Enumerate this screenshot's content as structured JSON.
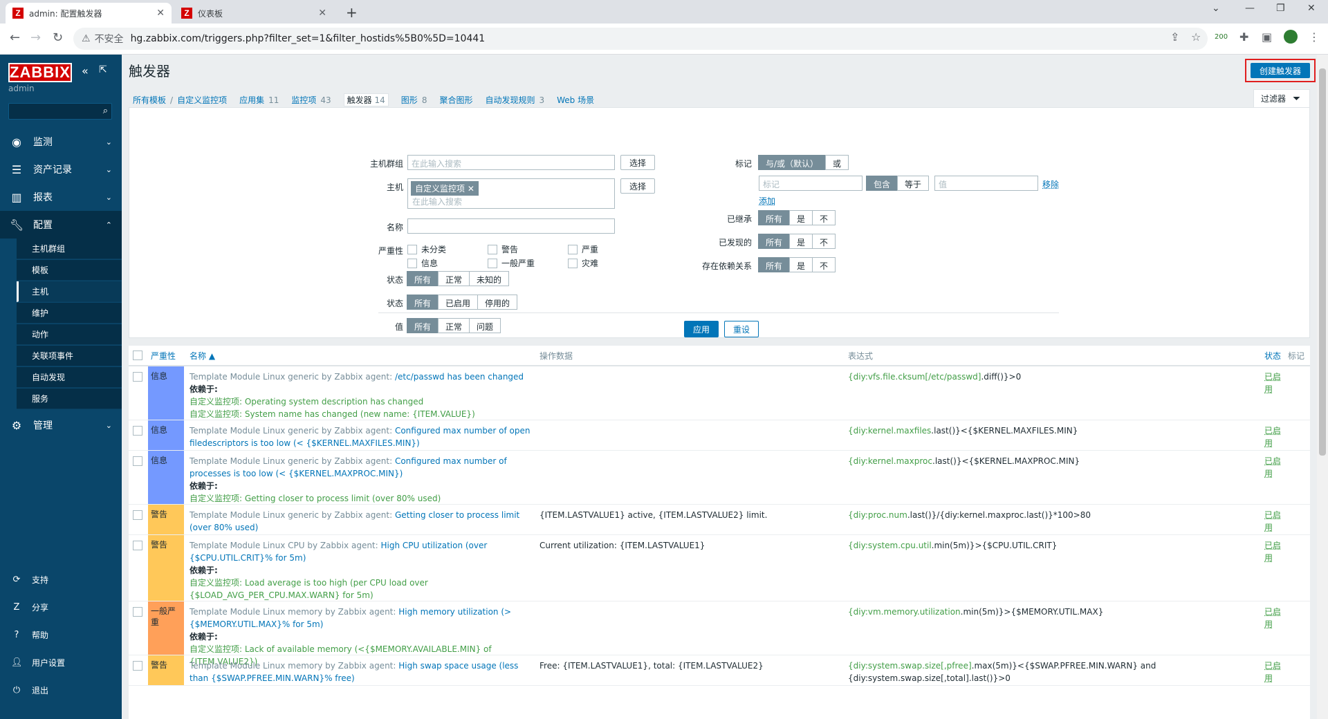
{
  "browser": {
    "tabs": [
      {
        "title": "admin: 配置触发器",
        "favicon": "Z"
      },
      {
        "title": "仪表板",
        "favicon": "Z"
      }
    ],
    "insecure": "不安全",
    "url": "hg.zabbix.com/triggers.php?filter_set=1&filter_hostids%5B0%5D=10441",
    "ext_badge": "200"
  },
  "sidebar": {
    "logo": "ZABBIX",
    "user": "admin",
    "menu": [
      {
        "label": "监测",
        "icon": "eye-icon"
      },
      {
        "label": "资产记录",
        "icon": "list-icon"
      },
      {
        "label": "报表",
        "icon": "bar-chart-icon"
      },
      {
        "label": "配置",
        "icon": "wrench-icon"
      }
    ],
    "config_items": [
      "主机群组",
      "模板",
      "主机",
      "维护",
      "动作",
      "关联项事件",
      "自动发现",
      "服务"
    ],
    "admin": {
      "label": "管理",
      "icon": "gear-icon"
    },
    "bottom": [
      {
        "label": "支持",
        "icon": "support-icon"
      },
      {
        "label": "分享",
        "icon": "share-icon"
      },
      {
        "label": "帮助",
        "icon": "help-icon"
      },
      {
        "label": "用户设置",
        "icon": "user-icon"
      },
      {
        "label": "退出",
        "icon": "power-icon"
      }
    ]
  },
  "header": {
    "title": "触发器",
    "create_button": "创建触发器"
  },
  "breadcrumb": {
    "all_templates": "所有模板",
    "separator": "/",
    "host": "自定义监控项",
    "apps": "应用集",
    "apps_count": "11",
    "items": "监控项",
    "items_count": "43",
    "triggers": "触发器",
    "triggers_count": "14",
    "graphs": "图形",
    "graphs_count": "8",
    "screens": "聚合图形",
    "discovery": "自动发现规则",
    "discovery_count": "3",
    "web": "Web 场景"
  },
  "filter": {
    "tab_label": "过滤器",
    "host_group_label": "主机群组",
    "host_label": "主机",
    "name_label": "名称",
    "severity_label": "严重性",
    "state_label": "状态",
    "status_label": "状态",
    "value_label": "值",
    "search_placeholder": "在此输入搜索",
    "select": "选择",
    "host_chip": "自定义监控项",
    "severities": [
      "未分类",
      "警告",
      "严重",
      "信息",
      "一般严重",
      "灾难"
    ],
    "state_opts": [
      "所有",
      "正常",
      "未知的"
    ],
    "status_opts": [
      "所有",
      "已启用",
      "停用的"
    ],
    "value_opts": [
      "所有",
      "正常",
      "问题"
    ],
    "tags_label": "标记",
    "tags_opts": [
      "与/或（默认）",
      "或"
    ],
    "tag_placeholder": "标记",
    "tag_ops": [
      "包含",
      "等于"
    ],
    "value_placeholder": "值",
    "remove": "移除",
    "add": "添加",
    "inherited_label": "已继承",
    "discovered_label": "已发现的",
    "depends_label": "存在依赖关系",
    "yn_opts": [
      "所有",
      "是",
      "不"
    ],
    "apply": "应用",
    "reset": "重设"
  },
  "table": {
    "headers": {
      "severity": "严重性",
      "name": "名称 ▲",
      "ops": "操作数据",
      "expr": "表达式",
      "status": "状态",
      "tags": "标记"
    },
    "depends_label": "依赖于:",
    "rows": [
      {
        "severity": "信息",
        "color": "#7499ff",
        "tpl": "Template Module Linux generic by Zabbix agent: ",
        "name": "/etc/passwd has been changed",
        "deps": [
          "自定义监控项: Operating system description has changed",
          "自定义监控项: System name has changed (new name: {ITEM.VALUE})"
        ],
        "ops": "",
        "expr_g": "{diy:vfs.file.cksum[/etc/passwd]",
        "expr_rest": ".diff()}>0",
        "status": "已启用"
      },
      {
        "severity": "信息",
        "color": "#7499ff",
        "tpl": "Template Module Linux generic by Zabbix agent: ",
        "name": "Configured max number of open filedescriptors is too low (< {$KERNEL.MAXFILES.MIN})",
        "deps": [],
        "ops": "",
        "expr_g": "{diy:kernel.maxfiles",
        "expr_rest": ".last()}<{$KERNEL.MAXFILES.MIN}",
        "status": "已启用"
      },
      {
        "severity": "信息",
        "color": "#7499ff",
        "tpl": "Template Module Linux generic by Zabbix agent: ",
        "name": "Configured max number of processes is too low (< {$KERNEL.MAXPROC.MIN})",
        "deps": [
          "自定义监控项: Getting closer to process limit (over 80% used)"
        ],
        "ops": "",
        "expr_g": "{diy:kernel.maxproc",
        "expr_rest": ".last()}<{$KERNEL.MAXPROC.MIN}",
        "status": "已启用"
      },
      {
        "severity": "警告",
        "color": "#ffc859",
        "tpl": "Template Module Linux generic by Zabbix agent: ",
        "name": "Getting closer to process limit (over 80% used)",
        "deps": [],
        "ops": "{ITEM.LASTVALUE1} active, {ITEM.LASTVALUE2} limit.",
        "expr_g": "{diy:proc.num",
        "expr_rest": ".last()}/{diy:kernel.maxproc.last()}*100>80",
        "status": "已启用"
      },
      {
        "severity": "警告",
        "color": "#ffc859",
        "tpl": "Template Module Linux CPU by Zabbix agent: ",
        "name": "High CPU utilization (over {$CPU.UTIL.CRIT}% for 5m)",
        "deps": [
          "自定义监控项: Load average is too high (per CPU load over {$LOAD_AVG_PER_CPU.MAX.WARN} for 5m)"
        ],
        "ops": "Current utilization: {ITEM.LASTVALUE1}",
        "expr_g": "{diy:system.cpu.util",
        "expr_rest": ".min(5m)}>{$CPU.UTIL.CRIT}",
        "status": "已启用"
      },
      {
        "severity": "一般严重",
        "color": "#ffa059",
        "tpl": "Template Module Linux memory by Zabbix agent: ",
        "name": "High memory utilization (>{$MEMORY.UTIL.MAX}% for 5m)",
        "deps": [
          "自定义监控项: Lack of available memory (<{$MEMORY.AVAILABLE.MIN} of {ITEM.VALUE2})"
        ],
        "ops": "",
        "expr_g": "{diy:vm.memory.utilization",
        "expr_rest": ".min(5m)}>{$MEMORY.UTIL.MAX}",
        "status": "已启用"
      },
      {
        "severity": "警告",
        "color": "#ffc859",
        "tpl": "Template Module Linux memory by Zabbix agent: ",
        "name": "High swap space usage (less than {$SWAP.PFREE.MIN.WARN}% free)",
        "deps": [],
        "ops": "Free: {ITEM.LASTVALUE1}, total: {ITEM.LASTVALUE2}",
        "expr_g": "{diy:system.swap.size[,pfree]",
        "expr_rest": ".max(5m)}<{$SWAP.PFREE.MIN.WARN} and {diy:system.swap.size[,total].last()}>0",
        "status": "已启用"
      }
    ]
  }
}
